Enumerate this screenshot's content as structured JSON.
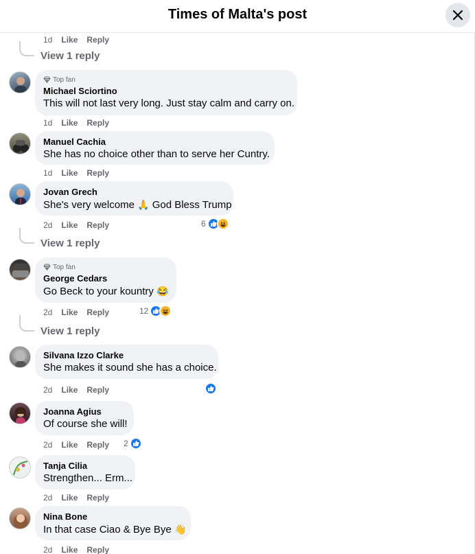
{
  "header": {
    "title": "Times of Malta's post"
  },
  "colors": {
    "accent": "#1877f2",
    "bubble": "#f0f2f5",
    "muted": "#65676b"
  },
  "top_fragment": {
    "time": "1d",
    "like": "Like",
    "reply": "Reply",
    "view_replies": "View 1 reply"
  },
  "comments": [
    {
      "top_fan": "Top fan",
      "author": "Michael Sciortino",
      "text": "This will not last very long. Just stay calm and carry on.",
      "time": "1d",
      "like": "Like",
      "reply": "Reply"
    },
    {
      "author": "Manuel Cachia",
      "text": "She has no choice other than to serve her Cuntry.",
      "time": "1d",
      "like": "Like",
      "reply": "Reply"
    },
    {
      "author": "Jovan Grech",
      "text_before": "She's very welcome",
      "emoji": "🙏",
      "text_after": "God Bless Trump",
      "time": "2d",
      "like": "Like",
      "reply": "Reply",
      "reaction_count": "6",
      "view_replies": "View 1 reply"
    },
    {
      "top_fan": "Top fan",
      "author": "George Cedars",
      "text": "Go Beck to your kountry",
      "emoji": "😂",
      "time": "2d",
      "like": "Like",
      "reply": "Reply",
      "reaction_count": "12",
      "view_replies": "View 1 reply"
    },
    {
      "author": "Silvana Izzo Clarke",
      "text": "She makes it sound she has a choice.",
      "time": "2d",
      "like": "Like",
      "reply": "Reply"
    },
    {
      "author": "Joanna Agius",
      "text": "Of course she will!",
      "time": "2d",
      "like": "Like",
      "reply": "Reply",
      "reaction_count": "2"
    },
    {
      "author": "Tanja Cilia",
      "text": "Strengthen... Erm...",
      "time": "2d",
      "like": "Like",
      "reply": "Reply"
    },
    {
      "author": "Nina Bone",
      "text": "In that case Ciao & Bye Bye",
      "emoji": "👋",
      "time": "2d",
      "like": "Like",
      "reply": "Reply"
    }
  ]
}
